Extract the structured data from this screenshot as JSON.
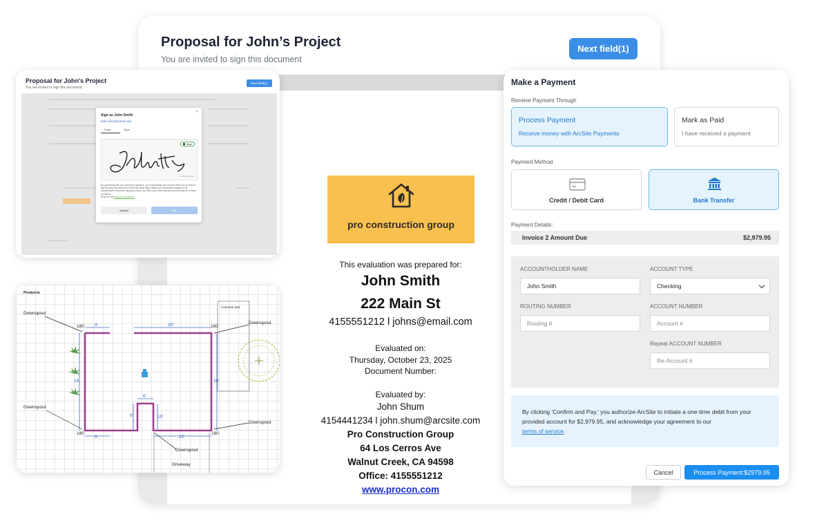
{
  "document": {
    "title": "Proposal for John’s Project",
    "subtitle": "You are invited to sign this document",
    "next_button": "Next field(1)",
    "logo_text": "pro construction group",
    "prepared_for_label": "This evaluation was prepared for:",
    "client_name": "John Smith",
    "client_address": "222 Main St",
    "client_contact": "4155551212 l johns@email.com",
    "evaluated_on_label": "Evaluated on:",
    "evaluated_on_date": "Thursday, October 23, 2025",
    "document_number_label": "Document Number:",
    "evaluated_by_label": "Evaluated by:",
    "evaluator_name": "John Shum",
    "evaluator_contact": "4154441234 l john.shum@arcsite.com",
    "company_name": "Pro Construction Group",
    "company_street": "64 Los Cerros Ave",
    "company_city": "Walnut Creek, CA 94598",
    "company_office": "Office: 4155551212",
    "company_website": "www.procon.com",
    "brand_color": "#f9c04f"
  },
  "signature_preview": {
    "title": "Proposal for John's Project",
    "subtitle": "You are invited to sign this document",
    "next_button": "Next field(1)",
    "modal_title": "Sign as John Smith",
    "modal_email": "fohn-client@shum.net",
    "tab_draw": "Draw",
    "tab_type": "Type",
    "color_chip": "Black",
    "clear_label": "Clear signature",
    "legal_text": "By proceeding with your electronic signature, you acknowledge and consent that it can be used to sign the given document and holds the same legal validity as a handwritten signature. By completing the electronic signing process, you affirm your understanding and acceptance of these conditions.",
    "legal_link_prefix": "Read the full",
    "legal_link": "electronic agreement",
    "cancel_button": "Cancel",
    "sign_button": "Sign"
  },
  "floor_plan": {
    "app_name": "Products",
    "labels": {
      "downspout": "Downspout",
      "concrete_pad": "Concrete pad",
      "driveway": "Driveway",
      "d180": "180",
      "d9": "9'",
      "d30": "30'",
      "d38": "38'",
      "d6": "6'",
      "d10": "10'",
      "d22": "22'",
      "d18": "18"
    }
  },
  "payment": {
    "title": "Make a Payment",
    "receive_through_label": "Receive Payment Through",
    "option_process_title": "Process Payment",
    "option_process_desc": "Receive money with ArcSite Payments",
    "option_paid_title": "Mark as Paid",
    "option_paid_desc": "I have received a payment",
    "method_label": "Payment Method",
    "method_card": "Credit / Debit Card",
    "method_bank": "Bank Transfer",
    "details_label": "Payment Details:",
    "invoice_label": "Invoice 2 Amount Due",
    "invoice_amount": "$2,979.95",
    "holder_label": "ACCOUNTHOLDER NAME",
    "holder_value": "John Smith",
    "type_label": "ACCOUNT TYPE",
    "type_value": "Checking",
    "routing_label": "ROUTING NUMBER",
    "routing_placeholder": "Routing #",
    "account_label": "ACCOUNT NUMBER",
    "account_placeholder": "Account #",
    "repeat_label": "Repeat ACCOUNT NUMBER",
    "repeat_placeholder": "Re-Account #",
    "notice_text": "By clicking 'Confirm and Pay,' you authorize ArcSite to initiate a one-time debit from your provided account for $2,979.95, and acknowledge your agreement to our",
    "notice_link": "terms of service",
    "notice_end": ".",
    "cancel_button": "Cancel",
    "pay_button": "Process Payment:$2979.95",
    "accent_color": "#1b8ef0"
  }
}
